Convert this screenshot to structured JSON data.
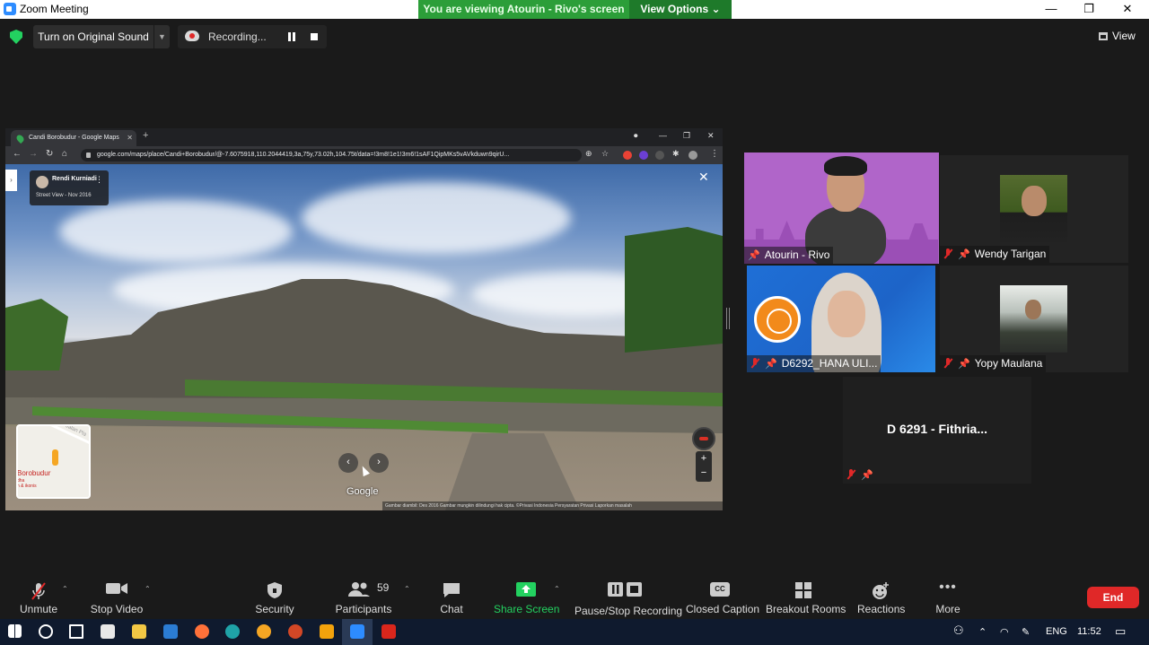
{
  "window": {
    "title": "Zoom Meeting",
    "viewing_banner": "You are viewing Atourin - Rivo's screen",
    "view_options": "View Options"
  },
  "top_controls": {
    "original_sound": "Turn on Original Sound",
    "recording": "Recording...",
    "view": "View"
  },
  "shared_screen": {
    "tab_title": "Candi Borobudur - Google Maps",
    "url": "google.com/maps/place/Candi+Borobudur/@-7.6075918,110.2044419,3a,75y,73.02h,104.75t/data=!3m8!1e1!3m6!1sAF1QipMKs5vAVkduwn9qirU...",
    "contributor": "Rendi Kurniadi",
    "capture_date": "Street View - Nov 2016",
    "minimap_label": "Borobudur",
    "minimap_sub": "dha\nn & ikonis",
    "minimap_road": "Jalan Pla",
    "google": "Google",
    "footer": "Gambar diambil: Des 2016    Gambar mungkin dilindungi hak cipta.    ©Privasi    Indonesia    Persyaratan    Privasi    Laporkan masalah"
  },
  "participants": [
    {
      "name": "Atourin - Rivo",
      "muted": false
    },
    {
      "name": "Wendy Tarigan",
      "muted": true
    },
    {
      "name": "D6292_HANA ULI...",
      "muted": true
    },
    {
      "name": "Yopy Maulana",
      "muted": true
    },
    {
      "name": "D 6291 - Fithria...",
      "muted": true
    }
  ],
  "toolbar": {
    "unmute": "Unmute",
    "stop_video": "Stop Video",
    "security": "Security",
    "participants": "Participants",
    "participants_count": "59",
    "chat": "Chat",
    "share_screen": "Share Screen",
    "pause_stop_recording": "Pause/Stop Recording",
    "closed_caption": "Closed Caption",
    "cc_badge": "CC",
    "breakout_rooms": "Breakout Rooms",
    "reactions": "Reactions",
    "more": "More",
    "end": "End"
  },
  "taskbar": {
    "language": "ENG",
    "time": "11:52"
  },
  "colors": {
    "banner_green": "#2c9e39",
    "share_green": "#23d160",
    "end_red": "#e02828",
    "active_speaker": "#e8e26a"
  }
}
